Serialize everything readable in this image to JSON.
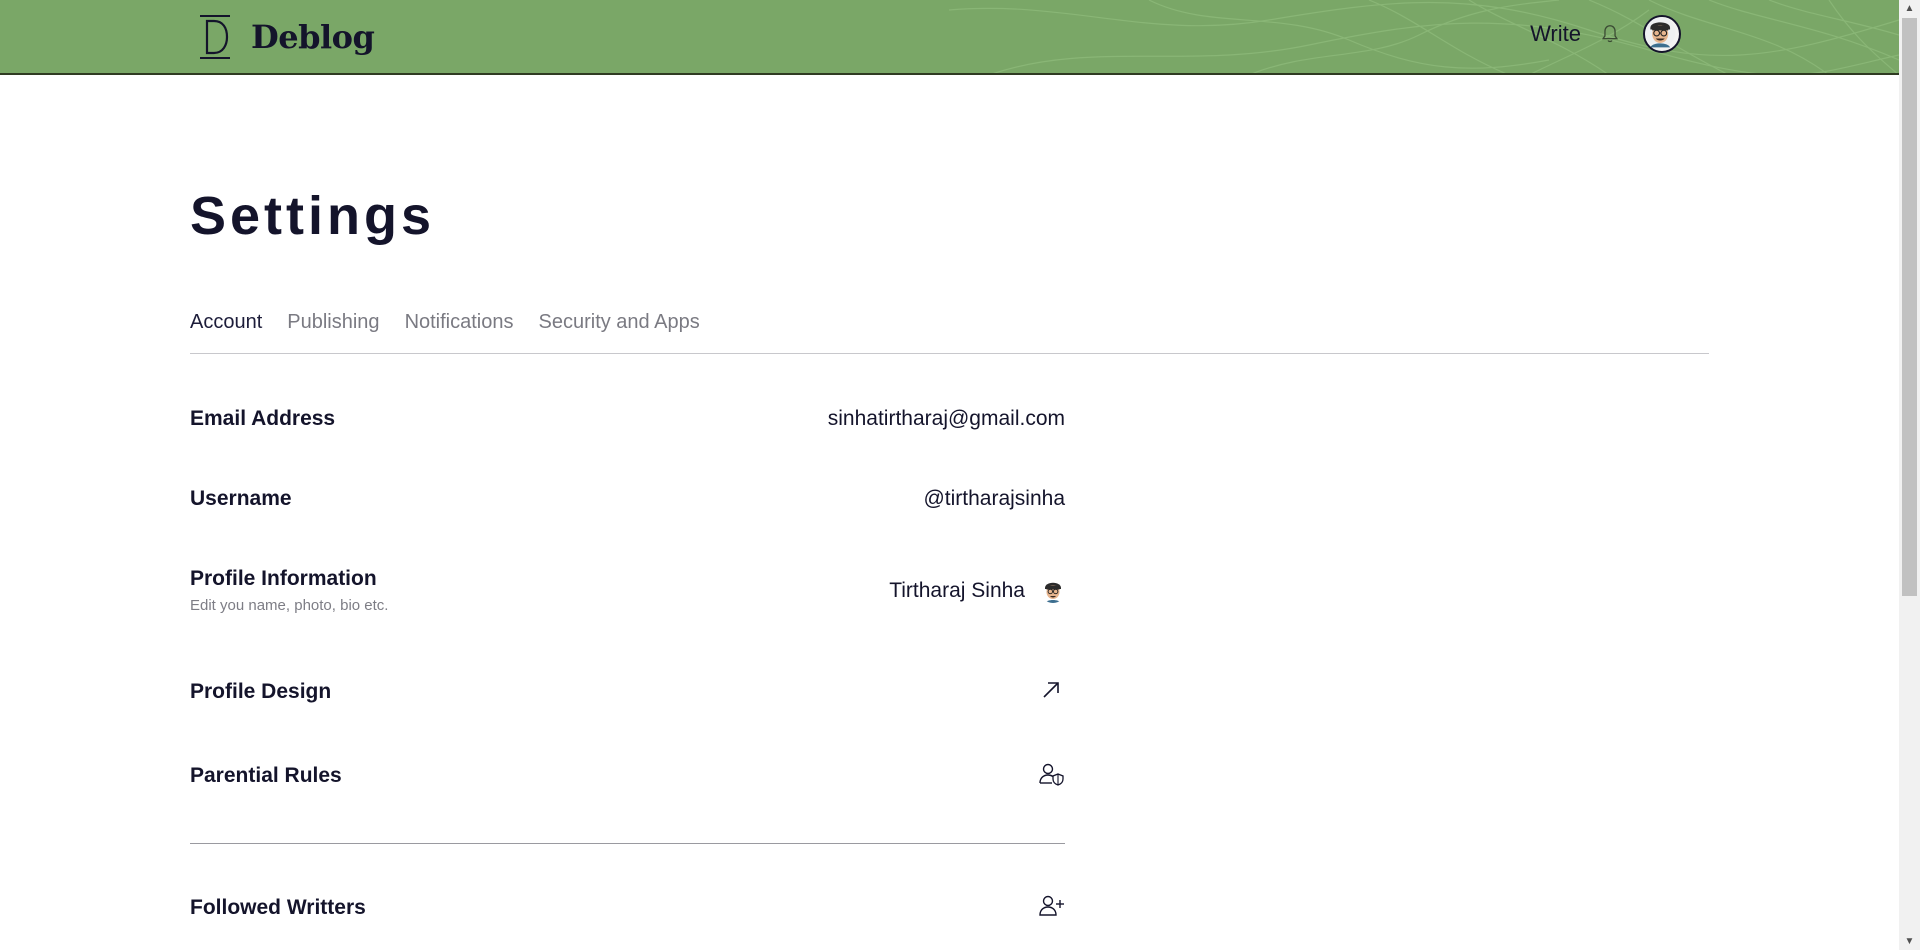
{
  "header": {
    "brand_name": "Deblog",
    "brand_letter": "D",
    "write_label": "Write",
    "bg_color": "#7aa767",
    "icons": {
      "logo": "deblog-logo-icon",
      "bell": "bell-icon",
      "avatar": "user-avatar"
    }
  },
  "page": {
    "title": "Settings"
  },
  "tabs": [
    {
      "label": "Account",
      "active": true
    },
    {
      "label": "Publishing",
      "active": false
    },
    {
      "label": "Notifications",
      "active": false
    },
    {
      "label": "Security and Apps",
      "active": false
    }
  ],
  "settings": {
    "email": {
      "label": "Email Address",
      "value": "sinhatirtharaj@gmail.com"
    },
    "username": {
      "label": "Username",
      "value": "@tirtharajsinha"
    },
    "profile_info": {
      "label": "Profile Information",
      "sub": "Edit you name, photo, bio etc.",
      "value": "Tirtharaj Sinha"
    },
    "profile_design": {
      "label": "Profile Design",
      "icon": "arrow-up-right-icon"
    },
    "parental_rules": {
      "label": "Parential Rules",
      "icon": "user-shield-icon"
    },
    "followed_writers": {
      "label": "Followed Writters",
      "icon": "user-plus-icon"
    }
  }
}
